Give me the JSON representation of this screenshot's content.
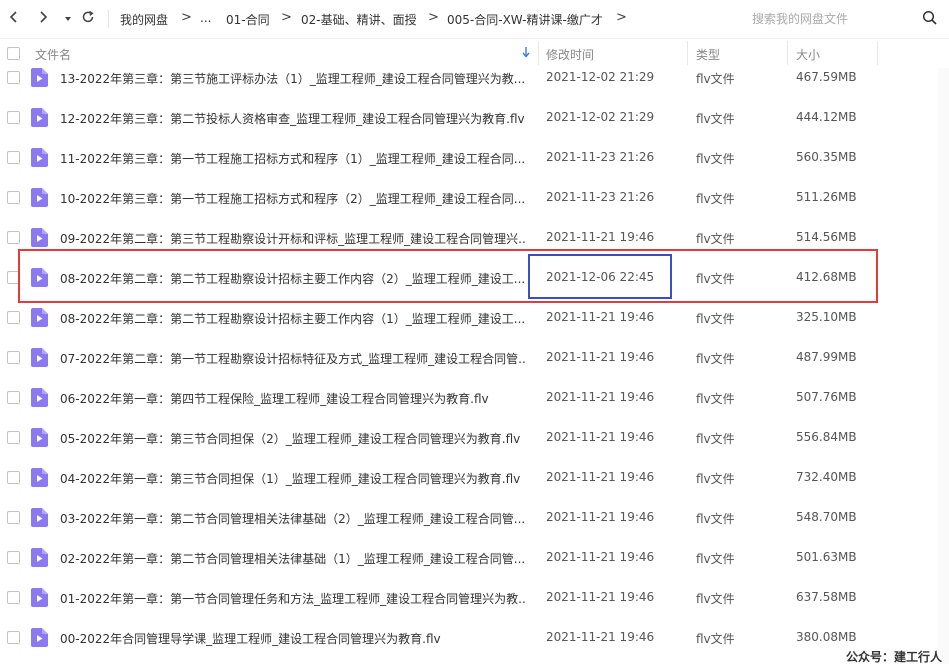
{
  "nav": {
    "back_icon": "chevron-left-icon",
    "forward_icon": "chevron-right-icon",
    "dropdown_icon": "caret-down-icon",
    "refresh_icon": "refresh-icon",
    "breadcrumbs": [
      "我的网盘",
      "...",
      "01-合同",
      "02-基础、精讲、面授",
      "005-合同-XW-精讲课-缴广才"
    ],
    "separator": ">",
    "search_placeholder": "搜索我的网盘文件",
    "search_icon": "search-icon"
  },
  "columns": {
    "name": "文件名",
    "sort_icon": "arrow-down-icon",
    "modified": "修改时间",
    "type": "类型",
    "size": "大小"
  },
  "colors": {
    "accent": "#3a7cf0",
    "file_icon": "#8c78f0",
    "highlight_red": "#e03c3c",
    "highlight_blue": "#3a4fc2"
  },
  "files": [
    {
      "name": "13-2022年第三章：第三节施工评标办法（1）_监理工程师_建设工程合同管理兴为教...",
      "date": "2021-12-02 21:29",
      "type": "flv文件",
      "size": "467.59MB"
    },
    {
      "name": "12-2022年第三章：第二节投标人资格审查_监理工程师_建设工程合同管理兴为教育.flv",
      "date": "2021-12-02 21:29",
      "type": "flv文件",
      "size": "444.12MB"
    },
    {
      "name": "11-2022年第三章：第一节工程施工招标方式和程序（1）_监理工程师_建设工程合同...",
      "date": "2021-11-23 21:26",
      "type": "flv文件",
      "size": "560.35MB"
    },
    {
      "name": "10-2022年第三章：第一节工程施工招标方式和程序（2）_监理工程师_建设工程合同...",
      "date": "2021-11-23 21:26",
      "type": "flv文件",
      "size": "511.26MB"
    },
    {
      "name": "09-2022年第二章：第三节工程勘察设计开标和评标_监理工程师_建设工程合同管理兴...",
      "date": "2021-11-21 19:46",
      "type": "flv文件",
      "size": "514.56MB"
    },
    {
      "name": "08-2022年第二章：第二节工程勘察设计招标主要工作内容（2）_监理工程师_建设工...",
      "date": "2021-12-06 22:45",
      "type": "flv文件",
      "size": "412.68MB"
    },
    {
      "name": "08-2022年第二章：第二节工程勘察设计招标主要工作内容（1）_监理工程师_建设工...",
      "date": "2021-11-21 19:46",
      "type": "flv文件",
      "size": "325.10MB"
    },
    {
      "name": "07-2022年第二章：第一节工程勘察设计招标特征及方式_监理工程师_建设工程合同管...",
      "date": "2021-11-21 19:46",
      "type": "flv文件",
      "size": "487.99MB"
    },
    {
      "name": "06-2022年第一章：第四节工程保险_监理工程师_建设工程合同管理兴为教育.flv",
      "date": "2021-11-21 19:46",
      "type": "flv文件",
      "size": "507.76MB"
    },
    {
      "name": "05-2022年第一章：第三节合同担保（2）_监理工程师_建设工程合同管理兴为教育.flv",
      "date": "2021-11-21 19:46",
      "type": "flv文件",
      "size": "556.84MB"
    },
    {
      "name": "04-2022年第一章：第三节合同担保（1）_监理工程师_建设工程合同管理兴为教育.flv",
      "date": "2021-11-21 19:46",
      "type": "flv文件",
      "size": "732.40MB"
    },
    {
      "name": "03-2022年第一章：第二节合同管理相关法律基础（2）_监理工程师_建设工程合同管...",
      "date": "2021-11-21 19:46",
      "type": "flv文件",
      "size": "548.70MB"
    },
    {
      "name": "02-2022年第一章：第二节合同管理相关法律基础（1）_监理工程师_建设工程合同管...",
      "date": "2021-11-21 19:46",
      "type": "flv文件",
      "size": "501.63MB"
    },
    {
      "name": "01-2022年第一章：第一节合同管理任务和方法_监理工程师_建设工程合同管理兴为教...",
      "date": "2021-11-21 19:46",
      "type": "flv文件",
      "size": "637.58MB"
    },
    {
      "name": "00-2022年合同管理导学课_监理工程师_建设工程合同管理兴为教育.flv",
      "date": "2021-11-21 19:46",
      "type": "flv文件",
      "size": "380.08MB"
    }
  ],
  "watermark": "公众号：建工行人"
}
